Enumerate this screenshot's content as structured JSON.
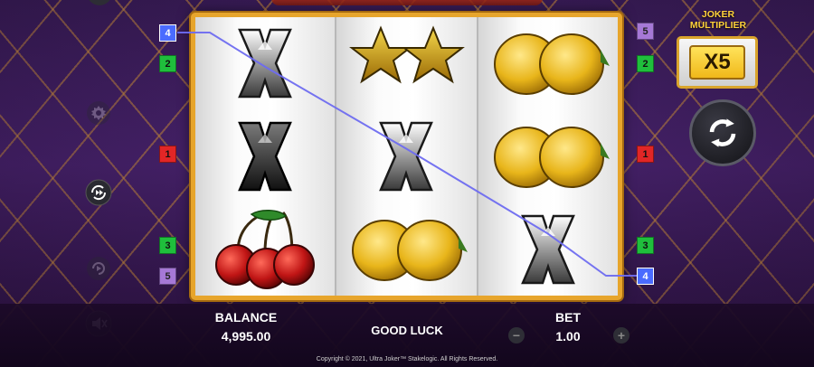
{
  "game": {
    "copyright": "Copyright © 2021, Ultra Joker™ Stakelogic. All Rights Reserved."
  },
  "reels": [
    [
      "x-symbol",
      "x-symbol",
      "cherries-symbol"
    ],
    [
      "stars-symbol",
      "x-symbol",
      "lemons-symbol"
    ],
    [
      "lemons-symbol",
      "lemons-symbol",
      "x-symbol"
    ]
  ],
  "winning_payline": 4,
  "line_markers": {
    "left": [
      {
        "label": "4",
        "color": "#4a6bff"
      },
      {
        "label": "2",
        "color": "#1fbf3c"
      },
      {
        "label": "1",
        "color": "#e12626"
      },
      {
        "label": "3",
        "color": "#1fbf3c"
      },
      {
        "label": "5",
        "color": "#a678d6"
      }
    ],
    "right": [
      {
        "label": "5",
        "color": "#a678d6"
      },
      {
        "label": "2",
        "color": "#1fbf3c"
      },
      {
        "label": "1",
        "color": "#e12626"
      },
      {
        "label": "3",
        "color": "#1fbf3c"
      },
      {
        "label": "4",
        "color": "#4a6bff"
      }
    ]
  },
  "side_buttons": [
    "settings-icon",
    "autoplay-icon",
    "turbo-icon",
    "sound-muted-icon"
  ],
  "joker": {
    "title": "JOKER MULTIPLIER",
    "multiplier": "X5"
  },
  "bottom": {
    "balance_label": "BALANCE",
    "balance_value": "4,995.00",
    "message": "GOOD LUCK",
    "bet_label": "BET",
    "bet_value": "1.00",
    "bet_minus": "−",
    "bet_plus": "+"
  },
  "colors": {
    "reel_border": "#e7a52c",
    "payline": "#6e6cf0",
    "joker_text": "#ffd23a"
  }
}
